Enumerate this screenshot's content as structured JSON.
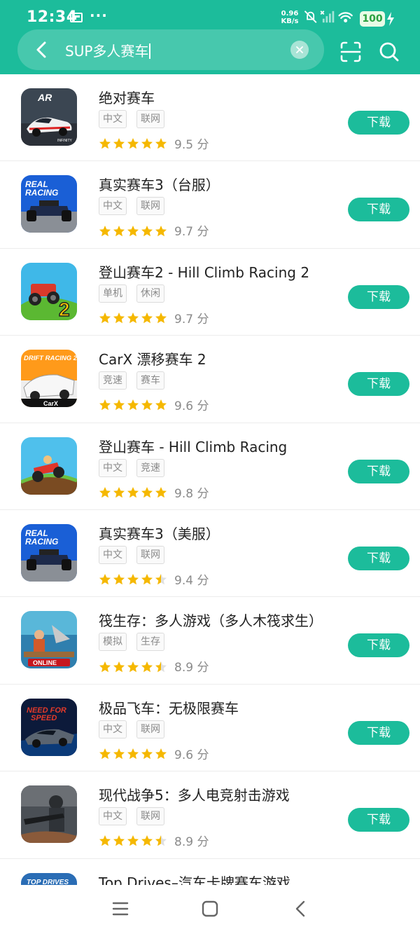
{
  "status_bar": {
    "time": "12:34",
    "dots": "···",
    "speed_value": "0.96",
    "speed_unit": "KB/s",
    "battery": "100"
  },
  "search": {
    "query": "SUP多人赛车"
  },
  "download_label": "下载",
  "score_unit": "分",
  "apps": [
    {
      "name": "绝对赛车",
      "tags": [
        "中文",
        "联网"
      ],
      "rating": 5,
      "score": "9.5",
      "icon": "asphalt-icon"
    },
    {
      "name": "真实赛车3（台服）",
      "tags": [
        "中文",
        "联网"
      ],
      "rating": 5,
      "score": "9.7",
      "icon": "real-racing-icon"
    },
    {
      "name": "登山赛车2 - Hill Climb Racing 2",
      "tags": [
        "单机",
        "休闲"
      ],
      "rating": 5,
      "score": "9.7",
      "icon": "hill-climb-2-icon"
    },
    {
      "name": "CarX 漂移赛车 2",
      "tags": [
        "竞速",
        "赛车"
      ],
      "rating": 5,
      "score": "9.6",
      "icon": "drift-racing-icon"
    },
    {
      "name": "登山赛车 - Hill Climb Racing",
      "tags": [
        "中文",
        "竞速"
      ],
      "rating": 5,
      "score": "9.8",
      "icon": "hill-climb-icon"
    },
    {
      "name": "真实赛车3（美服）",
      "tags": [
        "中文",
        "联网"
      ],
      "rating": 4.5,
      "score": "9.4",
      "icon": "real-racing-icon"
    },
    {
      "name": "筏生存：多人游戏（多人木筏求生）",
      "tags": [
        "模拟",
        "生存"
      ],
      "rating": 4.5,
      "score": "8.9",
      "icon": "raft-survival-icon"
    },
    {
      "name": "极品飞车：无极限赛车",
      "tags": [
        "中文",
        "联网"
      ],
      "rating": 5,
      "score": "9.6",
      "icon": "need-for-speed-icon"
    },
    {
      "name": "现代战争5：多人电竞射击游戏",
      "tags": [
        "中文",
        "联网"
      ],
      "rating": 4.5,
      "score": "8.9",
      "icon": "modern-combat-icon"
    }
  ],
  "partial_app": {
    "name": "Top Drives–汽车卡牌赛车游戏",
    "icon": "top-drives-icon"
  },
  "icon_text": {
    "asphalt": "AR",
    "asphalt_sub": "INFINITY",
    "real": "REAL",
    "racing": "RACING",
    "hill2": "2",
    "drift": "DRIFT RACING 2",
    "carx": "CarX",
    "online": "ONLINE",
    "nfs1": "NEED FOR",
    "nfs2": "SPEED",
    "top_drives": "TOP DRIVES"
  },
  "colors": {
    "accent": "#1cbc9b",
    "star": "#f5b800",
    "star_empty": "#e0e0e0"
  }
}
